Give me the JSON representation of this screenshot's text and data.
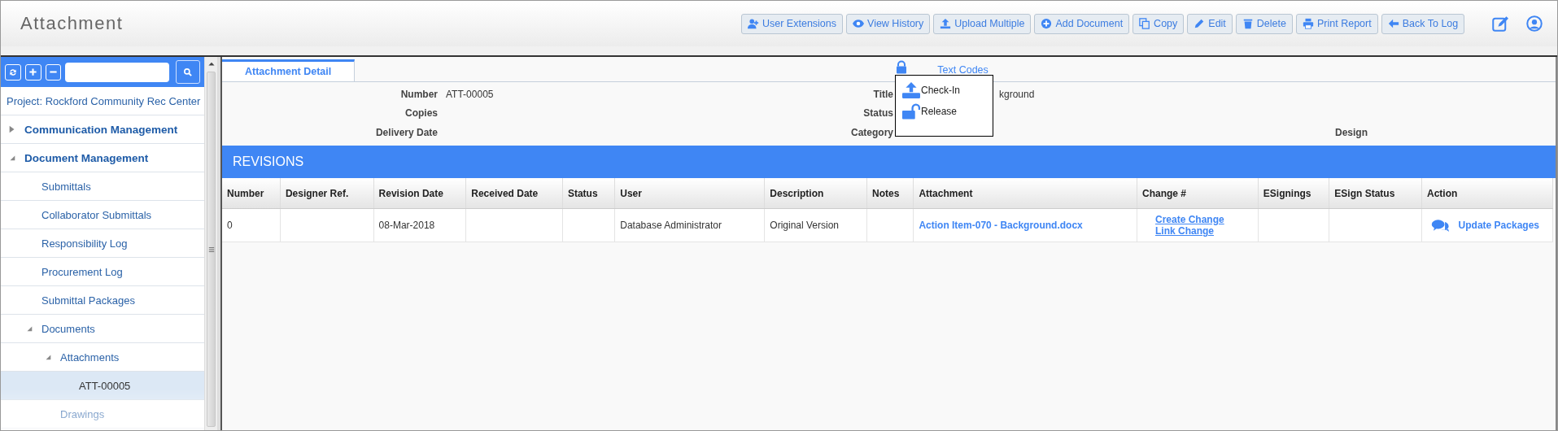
{
  "header": {
    "title": "Attachment",
    "buttons": [
      "User Extensions",
      "View History",
      "Upload Multiple",
      "Add Document",
      "Copy",
      "Edit",
      "Delete",
      "Print Report",
      "Back To Log"
    ]
  },
  "sidebar": {
    "project": "Project: Rockford Community Rec Center",
    "tree": [
      {
        "label": "Communication Management",
        "expanded": false
      },
      {
        "label": "Document Management",
        "expanded": true,
        "children": [
          {
            "label": "Submittals",
            "selected": false
          },
          {
            "label": "Collaborator Submittals",
            "selected": false
          },
          {
            "label": "Responsibility Log",
            "selected": false
          },
          {
            "label": "Procurement Log",
            "selected": false
          },
          {
            "label": "Submittal Packages",
            "selected": false
          },
          {
            "label": "Documents",
            "expanded": true,
            "children": [
              {
                "label": "Attachments",
                "expanded": true,
                "children": [
                  {
                    "label": "ATT-00005",
                    "selected": true
                  }
                ]
              },
              {
                "label": "Drawings",
                "selected": false
              }
            ]
          }
        ]
      }
    ]
  },
  "tabs": [
    {
      "label": "Attachment Detail",
      "selected": true
    },
    {
      "label": "Text Codes",
      "selected": false
    }
  ],
  "fields": [
    [
      {
        "label": "Number",
        "value": "ATT-00005"
      },
      {
        "label": "Title",
        "value": "kground"
      }
    ],
    [
      {
        "label": "Copies"
      },
      {
        "label": "Status"
      }
    ],
    [
      {
        "label": "Delivery Date"
      },
      {
        "label": "Category"
      },
      {
        "label": "Design"
      }
    ]
  ],
  "lock_menu": [
    "Check-In",
    "Release"
  ],
  "revisions": {
    "title": "REVISIONS",
    "columns": [
      "Number",
      "Designer Ref.",
      "Revision Date",
      "Received Date",
      "Status",
      "User",
      "Description",
      "Notes",
      "Attachment",
      "Change #",
      "ESignings",
      "ESign Status",
      "Action"
    ],
    "rows": [
      {
        "number": "0",
        "designer_ref": "",
        "revision_date": "08-Mar-2018",
        "received_date": "",
        "status": "",
        "user": "Database Administrator",
        "description": "Original Version",
        "notes": "",
        "attachment": "Action Item-070 - Background.docx",
        "change_links": [
          "Create Change",
          "Link Change"
        ],
        "esignings": "",
        "esign_status": "",
        "action": "Update Packages"
      }
    ]
  }
}
